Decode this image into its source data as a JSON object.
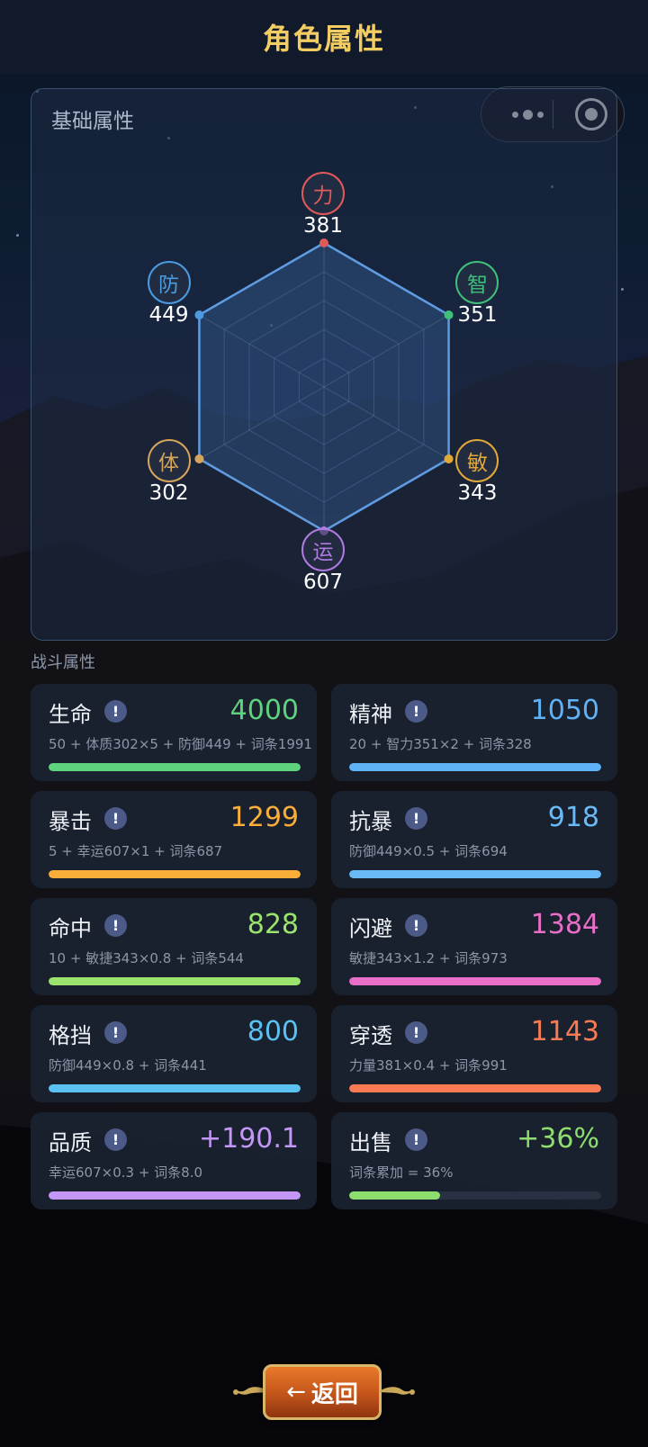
{
  "header": {
    "title": "角色属性"
  },
  "base": {
    "title": "基础属性",
    "attrs": [
      {
        "char": "力",
        "value": "381",
        "color": "#e05a5a"
      },
      {
        "char": "智",
        "value": "351",
        "color": "#3fbf7a"
      },
      {
        "char": "敏",
        "value": "343",
        "color": "#e0a93a"
      },
      {
        "char": "运",
        "value": "607",
        "color": "#b07ae0"
      },
      {
        "char": "体",
        "value": "302",
        "color": "#d6a55a"
      },
      {
        "char": "防",
        "value": "449",
        "color": "#4a9ae0"
      }
    ]
  },
  "combat": {
    "title": "战斗属性",
    "cards": [
      {
        "name": "生命",
        "value": "4000",
        "formula": "50 + 体质302×5 + 防御449 + 词条1991",
        "color": "#5ed27c",
        "fill": 1.0
      },
      {
        "name": "精神",
        "value": "1050",
        "formula": "20 + 智力351×2 + 词条328",
        "color": "#5fb2f6",
        "fill": 1.0
      },
      {
        "name": "暴击",
        "value": "1299",
        "formula": "5 + 幸运607×1 + 词条687",
        "color": "#f9ae3a",
        "fill": 1.0
      },
      {
        "name": "抗暴",
        "value": "918",
        "formula": "防御449×0.5 + 词条694",
        "color": "#69baf6",
        "fill": 1.0
      },
      {
        "name": "命中",
        "value": "828",
        "formula": "10 + 敏捷343×0.8 + 词条544",
        "color": "#9be36c",
        "fill": 1.0
      },
      {
        "name": "闪避",
        "value": "1384",
        "formula": "敏捷343×1.2 + 词条973",
        "color": "#e96ec7",
        "fill": 1.0
      },
      {
        "name": "格挡",
        "value": "800",
        "formula": "防御449×0.8 + 词条441",
        "color": "#5ac1f2",
        "fill": 1.0
      },
      {
        "name": "穿透",
        "value": "1143",
        "formula": "力量381×0.4 + 词条991",
        "color": "#f97b54",
        "fill": 1.0
      },
      {
        "name": "品质",
        "value": "+190.1",
        "formula": "幸运607×0.3 + 词条8.0",
        "color": "#c497f7",
        "fill": 1.0
      },
      {
        "name": "出售",
        "value": "+36%",
        "formula": "词条累加 = 36%",
        "color": "#8ede6e",
        "fill": 0.36
      }
    ]
  },
  "back_button": {
    "label": "返回",
    "arrow": "←"
  },
  "capsule": {
    "more_icon": "more-dots-icon",
    "close_icon": "target-close-icon"
  }
}
